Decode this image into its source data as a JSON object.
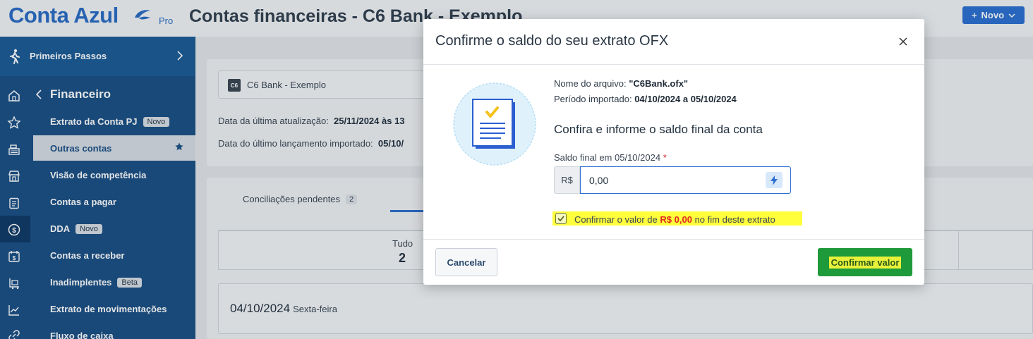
{
  "header": {
    "logo_text": "Conta Azul",
    "logo_sub": "Pro",
    "page_title": "Contas financeiras - C6 Bank - Exemplo",
    "new_button": "Novo"
  },
  "sidebar": {
    "primeiros_passos": "Primeiros Passos",
    "section_title": "Financeiro",
    "items": [
      {
        "label": "Extrato da Conta PJ",
        "badge": "Novo"
      },
      {
        "label": "Outras contas"
      },
      {
        "label": "Visão de competência"
      },
      {
        "label": "Contas a pagar"
      },
      {
        "label": "DDA",
        "badge": "Novo"
      },
      {
        "label": "Contas a receber"
      },
      {
        "label": "Inadimplentes",
        "badge": "Beta"
      },
      {
        "label": "Extrato de movimentações"
      },
      {
        "label": "Fluxo de caixa"
      }
    ]
  },
  "main": {
    "bank_logo": "C6",
    "bank_name": "C6 Bank - Exemplo",
    "last_update_label": "Data da última atualização:",
    "last_update_value": "25/11/2024 às 13",
    "last_import_label": "Data do último lançamento importado:",
    "last_import_value": "05/10/",
    "tab_pending": "Conciliações pendentes",
    "tab_pending_count": "2",
    "stat_label": "Tudo",
    "stat_value": "2",
    "date_main": "04/10/2024",
    "date_weekday": "Sexta-feira"
  },
  "modal": {
    "title": "Confirme o saldo do seu extrato OFX",
    "file_label": "Nome do arquivo:",
    "file_value": "\"C6Bank.ofx\"",
    "period_label": "Período importado:",
    "period_value": "04/10/2024 a 05/10/2024",
    "subtitle": "Confira e informe o saldo final da conta",
    "field_label": "Saldo final em 05/10/2024",
    "field_required": "*",
    "currency_prefix": "R$",
    "input_value": "0,00",
    "confirm_text_before": "Confirmar o valor de",
    "confirm_amount": "R$ 0,00",
    "confirm_text_after": "no fim deste extrato",
    "cancel_button": "Cancelar",
    "confirm_button": "Confirmar valor"
  },
  "colors": {
    "brand_blue": "#2b6cc4",
    "sidebar_blue": "#1b4f85",
    "confirm_green": "#1f9a3a",
    "highlight_yellow": "#ffff3c",
    "amount_red": "#e0281d"
  }
}
